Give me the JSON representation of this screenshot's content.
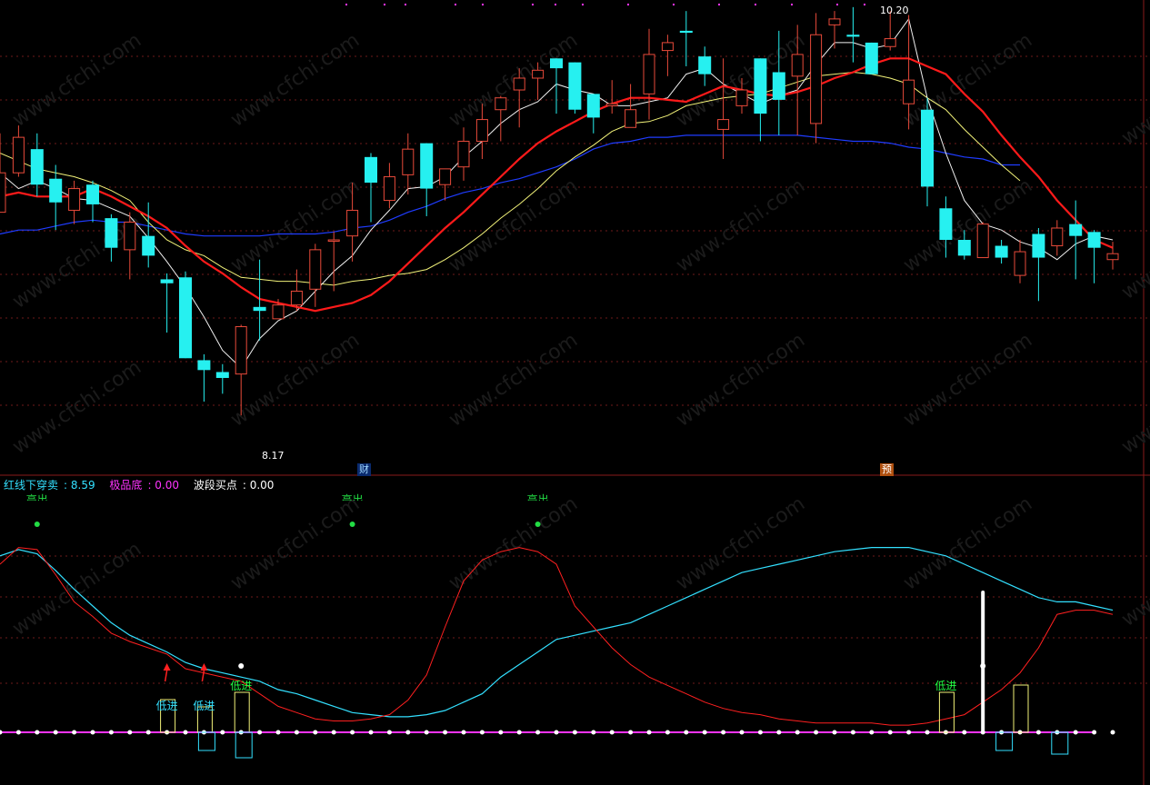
{
  "colors": {
    "background": "#000000",
    "up_candle": "#e84a3a",
    "down_candle": "#26f0f0",
    "ma_white": "#f0f0f0",
    "ma_red": "#ff1a1a",
    "ma_yellow": "#f2f279",
    "ma_blue": "#1f3cff",
    "grid": "#6e1a1a",
    "kdj_k": "#ff2020",
    "kdj_d": "#33e0ff",
    "magenta_base": "#ff33ff"
  },
  "upper_panel": {
    "high_label": "10.20",
    "low_label": "8.17",
    "badges": {
      "finance": "财",
      "forecast": "预"
    }
  },
  "lower_panel": {
    "legend": [
      {
        "name": "红线下穿卖",
        "value": "8.59"
      },
      {
        "name": "极品底",
        "value": "0.00"
      },
      {
        "name": "波段买点",
        "value": "0.00"
      }
    ],
    "annotations": [
      {
        "text": "低进",
        "index": 9,
        "color": "#33e0ff"
      },
      {
        "text": "低进",
        "index": 11,
        "color": "#33e0ff"
      },
      {
        "text": "低进",
        "index": 13,
        "color": "#22ff44"
      },
      {
        "text": "低进",
        "index": 51,
        "color": "#22ff44"
      }
    ],
    "top_markers": [
      {
        "text": "高出",
        "index": 2
      },
      {
        "text": "高出",
        "index": 19
      },
      {
        "text": "高出",
        "index": 29
      }
    ]
  },
  "chart_data": [
    {
      "type": "candlestick",
      "title": "",
      "ylim": [
        7.95,
        10.23
      ],
      "candles": [
        [
          9.2,
          9.4,
          9.6,
          9.28
        ],
        [
          9.4,
          9.58,
          9.64,
          9.38
        ],
        [
          9.52,
          9.34,
          9.6,
          9.28
        ],
        [
          9.37,
          9.25,
          9.44,
          9.11
        ],
        [
          9.21,
          9.32,
          9.36,
          9.14
        ],
        [
          9.34,
          9.24,
          9.36,
          9.15
        ],
        [
          9.17,
          9.02,
          9.19,
          8.95
        ],
        [
          9.01,
          9.15,
          9.2,
          8.86
        ],
        [
          9.08,
          8.98,
          9.25,
          8.92
        ],
        [
          8.86,
          8.84,
          8.89,
          8.59
        ],
        [
          8.87,
          8.46,
          8.9,
          8.46
        ],
        [
          8.45,
          8.4,
          8.48,
          8.24
        ],
        [
          8.39,
          8.36,
          8.43,
          8.28
        ],
        [
          8.38,
          8.62,
          8.63,
          8.17
        ],
        [
          8.72,
          8.7,
          8.96,
          8.55
        ],
        [
          8.66,
          8.73,
          8.76,
          8.66
        ],
        [
          8.73,
          8.8,
          8.91,
          8.7
        ],
        [
          8.81,
          9.01,
          9.04,
          8.72
        ],
        [
          9.06,
          9.06,
          9.1,
          8.8
        ],
        [
          9.08,
          9.21,
          9.35,
          8.95
        ],
        [
          9.48,
          9.35,
          9.5,
          9.15
        ],
        [
          9.26,
          9.38,
          9.45,
          9.22
        ],
        [
          9.39,
          9.52,
          9.6,
          9.29
        ],
        [
          9.55,
          9.32,
          9.55,
          9.18
        ],
        [
          9.34,
          9.42,
          9.42,
          9.26
        ],
        [
          9.43,
          9.56,
          9.63,
          9.36
        ],
        [
          9.56,
          9.67,
          9.75,
          9.47
        ],
        [
          9.72,
          9.78,
          9.79,
          9.56
        ],
        [
          9.82,
          9.88,
          9.93,
          9.63
        ],
        [
          9.88,
          9.92,
          9.96,
          9.77
        ],
        [
          9.98,
          9.93,
          9.98,
          9.7
        ],
        [
          9.96,
          9.72,
          9.96,
          9.7
        ],
        [
          9.8,
          9.68,
          9.8,
          9.6
        ],
        [
          9.74,
          9.75,
          9.87,
          9.7
        ],
        [
          9.63,
          9.72,
          9.85,
          9.65
        ],
        [
          9.8,
          10.0,
          10.13,
          9.67
        ],
        [
          10.02,
          10.06,
          10.1,
          9.89
        ],
        [
          10.12,
          10.11,
          10.22,
          9.94
        ],
        [
          9.99,
          9.9,
          10.04,
          9.84
        ],
        [
          9.62,
          9.67,
          9.98,
          9.47
        ],
        [
          9.74,
          9.82,
          9.88,
          9.7
        ],
        [
          9.98,
          9.7,
          9.98,
          9.56
        ],
        [
          9.91,
          9.77,
          10.12,
          9.59
        ],
        [
          9.89,
          10.0,
          10.15,
          9.59
        ],
        [
          9.65,
          10.1,
          10.21,
          9.55
        ],
        [
          10.15,
          10.18,
          10.22,
          10.03
        ],
        [
          10.1,
          10.09,
          10.24,
          9.96
        ],
        [
          10.06,
          9.9,
          10.06,
          9.9
        ],
        [
          10.04,
          10.08,
          10.22,
          10.02
        ],
        [
          9.75,
          9.87,
          10.2,
          9.62
        ],
        [
          9.72,
          9.33,
          9.78,
          9.23
        ],
        [
          9.22,
          9.06,
          9.28,
          8.97
        ],
        [
          9.06,
          8.98,
          9.11,
          8.96
        ],
        [
          8.97,
          9.14,
          9.15,
          9.01
        ],
        [
          9.03,
          8.97,
          9.06,
          8.94
        ],
        [
          8.88,
          9.0,
          9.06,
          8.84
        ],
        [
          9.09,
          8.97,
          9.12,
          8.75
        ],
        [
          9.03,
          9.12,
          9.16,
          8.98
        ],
        [
          9.14,
          9.08,
          9.26,
          8.86
        ],
        [
          9.1,
          9.02,
          9.11,
          8.84
        ],
        [
          8.96,
          8.99,
          9.05,
          8.91
        ]
      ],
      "ma_white": [
        9.4,
        9.32,
        9.36,
        9.32,
        9.27,
        9.26,
        9.22,
        9.18,
        9.07,
        8.95,
        8.82,
        8.67,
        8.5,
        8.41,
        8.56,
        8.65,
        8.7,
        8.8,
        8.9,
        8.98,
        9.11,
        9.21,
        9.32,
        9.33,
        9.38,
        9.48,
        9.56,
        9.65,
        9.72,
        9.76,
        9.85,
        9.82,
        9.8,
        9.74,
        9.74,
        9.76,
        9.78,
        9.9,
        9.93,
        9.85,
        9.8,
        9.75,
        9.79,
        9.82,
        9.95,
        10.06,
        10.06,
        10.03,
        10.05,
        10.18,
        9.78,
        9.5,
        9.26,
        9.14,
        9.11,
        9.05,
        9.02,
        8.96,
        9.04,
        9.08,
        9.06
      ],
      "ma_red": [
        9.28,
        9.3,
        9.28,
        9.28,
        9.28,
        9.32,
        9.28,
        9.23,
        9.18,
        9.12,
        9.03,
        8.95,
        8.89,
        8.82,
        8.76,
        8.74,
        8.72,
        8.7,
        8.72,
        8.74,
        8.78,
        8.85,
        8.94,
        9.03,
        9.12,
        9.2,
        9.29,
        9.38,
        9.47,
        9.55,
        9.61,
        9.66,
        9.71,
        9.75,
        9.78,
        9.78,
        9.77,
        9.76,
        9.8,
        9.84,
        9.82,
        9.8,
        9.79,
        9.81,
        9.84,
        9.88,
        9.91,
        9.95,
        9.98,
        9.98,
        9.94,
        9.9,
        9.8,
        9.71,
        9.59,
        9.48,
        9.38,
        9.26,
        9.16,
        9.06,
        9.02
      ],
      "ma_yellow": [
        9.5,
        9.46,
        9.42,
        9.4,
        9.38,
        9.35,
        9.31,
        9.26,
        9.15,
        9.06,
        9.01,
        8.98,
        8.92,
        8.87,
        8.86,
        8.85,
        8.85,
        8.84,
        8.83,
        8.85,
        8.86,
        8.88,
        8.89,
        8.91,
        8.96,
        9.02,
        9.09,
        9.17,
        9.24,
        9.32,
        9.41,
        9.48,
        9.54,
        9.61,
        9.65,
        9.66,
        9.69,
        9.74,
        9.76,
        9.78,
        9.79,
        9.8,
        9.83,
        9.86,
        9.89,
        9.9,
        9.91,
        9.9,
        9.88,
        9.85,
        9.78,
        9.72,
        9.62,
        9.53,
        9.44,
        9.36
      ],
      "ma_blue": [
        9.09,
        9.11,
        9.11,
        9.13,
        9.15,
        9.16,
        9.15,
        9.15,
        9.13,
        9.11,
        9.09,
        9.08,
        9.08,
        9.08,
        9.08,
        9.09,
        9.09,
        9.09,
        9.1,
        9.12,
        9.13,
        9.16,
        9.2,
        9.23,
        9.27,
        9.3,
        9.32,
        9.35,
        9.37,
        9.4,
        9.43,
        9.47,
        9.52,
        9.55,
        9.56,
        9.58,
        9.58,
        9.59,
        9.59,
        9.59,
        9.59,
        9.59,
        9.59,
        9.59,
        9.58,
        9.57,
        9.56,
        9.56,
        9.55,
        9.53,
        9.52,
        9.5,
        9.48,
        9.47,
        9.44,
        9.44
      ]
    },
    {
      "type": "line",
      "title": "",
      "ylim": [
        0,
        100
      ],
      "series": [
        {
          "values": [
            80,
            88,
            87,
            75,
            62,
            55,
            47,
            43,
            40,
            37,
            30,
            28,
            26,
            24,
            18,
            12,
            9,
            6,
            5,
            5,
            6,
            8,
            15,
            27,
            50,
            72,
            82,
            86,
            88,
            86,
            80,
            60,
            50,
            40,
            32,
            26,
            22,
            18,
            14,
            11,
            9,
            8,
            6,
            5,
            4,
            4,
            4,
            4,
            3,
            3,
            4,
            6,
            8,
            14,
            20,
            28,
            40,
            56,
            58,
            58,
            56
          ]
        },
        {
          "values": [
            84,
            87,
            85,
            77,
            68,
            60,
            52,
            46,
            42,
            38,
            33,
            30,
            28,
            26,
            24,
            20,
            18,
            15,
            12,
            9,
            8,
            7,
            7,
            8,
            10,
            14,
            18,
            26,
            32,
            38,
            44,
            46,
            48,
            50,
            52,
            56,
            60,
            64,
            68,
            72,
            76,
            78,
            80,
            82,
            84,
            86,
            87,
            88,
            88,
            88,
            86,
            84,
            80,
            76,
            72,
            68,
            64,
            62,
            62,
            60,
            58
          ]
        }
      ]
    }
  ]
}
